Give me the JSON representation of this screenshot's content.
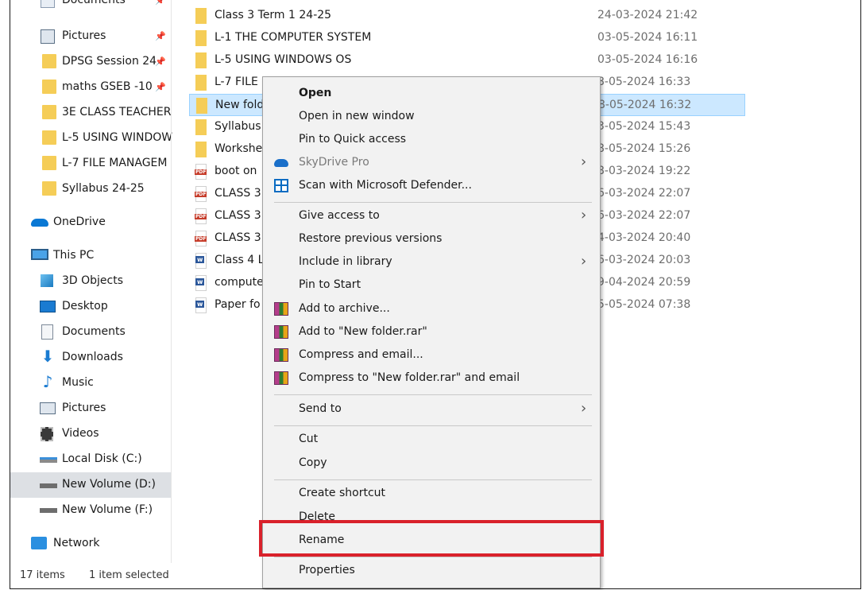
{
  "sidebar": {
    "quick_access": [
      {
        "label": "Documents",
        "icon": "documents-icon",
        "pinned": true
      },
      {
        "label": "Pictures",
        "icon": "pictures-icon",
        "pinned": true
      },
      {
        "label": "DPSG Session 24",
        "icon": "folder-icon",
        "pinned": true
      },
      {
        "label": "maths GSEB -10",
        "icon": "folder-icon",
        "pinned": true
      },
      {
        "label": "3E CLASS TEACHER",
        "icon": "folder-icon",
        "pinned": false
      },
      {
        "label": "L-5 USING WINDOW",
        "icon": "folder-icon",
        "pinned": false
      },
      {
        "label": "L-7 FILE MANAGEM",
        "icon": "folder-icon",
        "pinned": false
      },
      {
        "label": "Syllabus 24-25",
        "icon": "folder-icon",
        "pinned": false
      }
    ],
    "onedrive": "OneDrive",
    "this_pc": "This PC",
    "pc_items": [
      {
        "label": "3D Objects",
        "icon": "3d-objects-icon"
      },
      {
        "label": "Desktop",
        "icon": "desktop-icon"
      },
      {
        "label": "Documents",
        "icon": "documents-icon"
      },
      {
        "label": "Downloads",
        "icon": "downloads-icon"
      },
      {
        "label": "Music",
        "icon": "music-icon"
      },
      {
        "label": "Pictures",
        "icon": "pictures-icon"
      },
      {
        "label": "Videos",
        "icon": "videos-icon"
      },
      {
        "label": "Local Disk (C:)",
        "icon": "drive-icon"
      },
      {
        "label": "New Volume (D:)",
        "icon": "drive-icon",
        "selected": true
      },
      {
        "label": "New Volume (F:)",
        "icon": "drive-icon"
      }
    ],
    "network": "Network",
    "pin_glyph": "📌"
  },
  "status": {
    "items_count": "17 items",
    "selection": "1 item selected"
  },
  "files": [
    {
      "name": "Class 3 Term 1 24-25",
      "date": "24-03-2024 21:42",
      "type": "folder"
    },
    {
      "name": "L-1 THE COMPUTER SYSTEM",
      "date": "03-05-2024 16:11",
      "type": "folder"
    },
    {
      "name": "L-5 USING WINDOWS OS",
      "date": "03-05-2024 16:16",
      "type": "folder"
    },
    {
      "name": "L-7 FILE",
      "date": "8-05-2024 16:33",
      "type": "folder"
    },
    {
      "name": "New fold",
      "date": "8-05-2024 16:32",
      "type": "folder",
      "selected": true
    },
    {
      "name": "Syllabus",
      "date": "3-05-2024 15:43",
      "type": "folder"
    },
    {
      "name": "Workshe",
      "date": "8-05-2024 15:26",
      "type": "folder"
    },
    {
      "name": "boot on",
      "date": "8-03-2024 19:22",
      "type": "pdf"
    },
    {
      "name": "CLASS 3",
      "date": "6-03-2024 22:07",
      "type": "pdf"
    },
    {
      "name": "CLASS 3",
      "date": "6-03-2024 22:07",
      "type": "pdf"
    },
    {
      "name": "CLASS 3",
      "date": "4-03-2024 20:40",
      "type": "pdf"
    },
    {
      "name": "Class 4 L",
      "date": "6-03-2024 20:03",
      "type": "word"
    },
    {
      "name": "compute",
      "date": "9-04-2024 20:59",
      "type": "word"
    },
    {
      "name": "Paper fo",
      "date": "5-05-2024 07:38",
      "type": "word"
    }
  ],
  "context_menu": {
    "groups": [
      [
        {
          "label": "Open",
          "bold": true
        },
        {
          "label": "Open in new window"
        },
        {
          "label": "Pin to Quick access"
        },
        {
          "label": "SkyDrive Pro",
          "icon": "skydrive-icon",
          "submenu": true,
          "disabled": true
        },
        {
          "label": "Scan with Microsoft Defender...",
          "icon": "defender-icon"
        }
      ],
      [
        {
          "label": "Give access to",
          "submenu": true
        },
        {
          "label": "Restore previous versions"
        },
        {
          "label": "Include in library",
          "submenu": true
        },
        {
          "label": "Pin to Start"
        },
        {
          "label": "Add to archive...",
          "icon": "winrar-icon"
        },
        {
          "label": "Add to \"New folder.rar\"",
          "icon": "winrar-icon"
        },
        {
          "label": "Compress and email...",
          "icon": "winrar-icon"
        },
        {
          "label": "Compress to \"New folder.rar\" and email",
          "icon": "winrar-icon"
        }
      ],
      [
        {
          "label": "Send to",
          "submenu": true
        }
      ],
      [
        {
          "label": "Cut"
        },
        {
          "label": "Copy"
        }
      ],
      [
        {
          "label": "Create shortcut"
        },
        {
          "label": "Delete"
        },
        {
          "label": "Rename",
          "highlighted": true
        }
      ],
      [
        {
          "label": "Properties"
        }
      ]
    ],
    "submenu_glyph": "›"
  },
  "colors": {
    "highlight_border": "#d9212b",
    "selection_bg": "#cce8ff",
    "folder": "#f5cd57"
  }
}
